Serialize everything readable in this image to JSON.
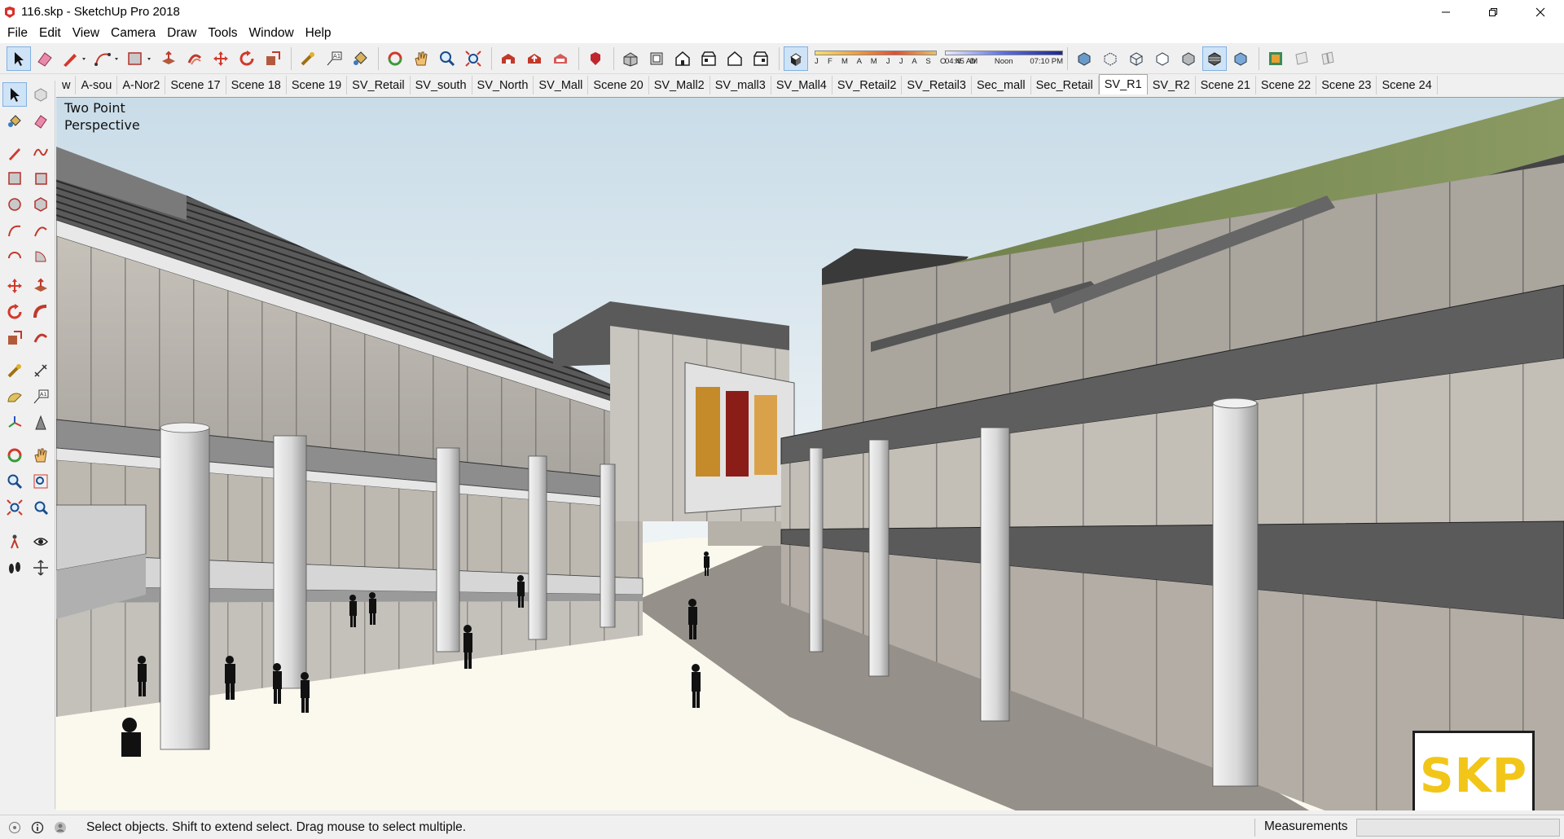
{
  "window": {
    "title": "116.skp - SketchUp Pro 2018"
  },
  "menu": [
    "File",
    "Edit",
    "View",
    "Camera",
    "Draw",
    "Tools",
    "Window",
    "Help"
  ],
  "shadow_settings": {
    "months": "J F M A M J J A S O N D",
    "time_start": "04:45 AM",
    "time_noon": "Noon",
    "time_end": "07:10 PM"
  },
  "scene_tabs": [
    "w",
    "A-sou",
    "A-Nor2",
    "Scene 17",
    "Scene 18",
    "Scene 19",
    "SV_Retail",
    "SV_south",
    "SV_North",
    "SV_Mall",
    "Scene 20",
    "SV_Mall2",
    "SV_mall3",
    "SV_Mall4",
    "SV_Retail2",
    "SV_Retail3",
    "Sec_mall",
    "Sec_Retail",
    "SV_R1",
    "SV_R2",
    "Scene 21",
    "Scene 22",
    "Scene 23",
    "Scene 24"
  ],
  "active_scene": "SV_R1",
  "viewport": {
    "camera_line1": "Two Point",
    "camera_line2": "Perspective",
    "badge": "SKP"
  },
  "status": {
    "text": "Select objects. Shift to extend select. Drag mouse to select multiple.",
    "measurements_label": "Measurements"
  },
  "colors": {
    "accent": "#cfe3f7",
    "badge": "#f2c619",
    "sky_top": "#cfe0ea",
    "ground": "#fbf8ee"
  }
}
